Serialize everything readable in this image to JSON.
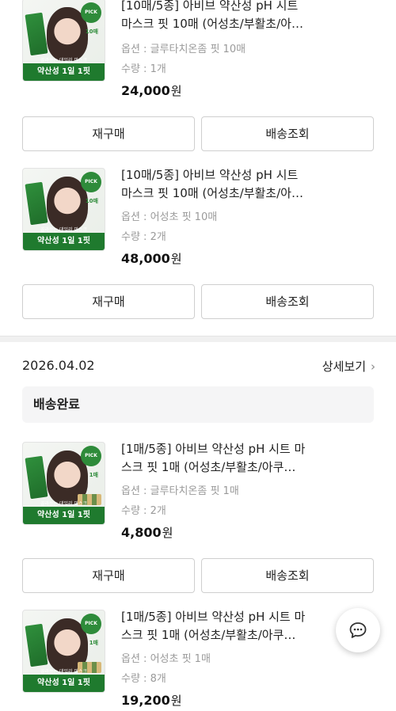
{
  "orders": [
    {
      "items": [
        {
          "title": "[10매/5종] 아비브 약산성 pH 시트\n마스크 핏 10매 (어성초/부활초/아…",
          "option": "옵션 : 글루타치온좀 핏 10매",
          "qty": "수량 : 1개",
          "price": "24,000",
          "currency": "원",
          "thumb": {
            "tag": "PICK",
            "count": "10매",
            "banner_top": "골라쓰는 데일리 마스크",
            "banner": "약산성 1일 1핏"
          },
          "buttons": {
            "reorder": "재구매",
            "track": "배송조회"
          }
        },
        {
          "title": "[10매/5종] 아비브 약산성 pH 시트\n마스크 핏 10매 (어성초/부활초/아…",
          "option": "옵션 : 어성초 핏 10매",
          "qty": "수량 : 2개",
          "price": "48,000",
          "currency": "원",
          "thumb": {
            "tag": "PICK",
            "count": "10매",
            "banner_top": "골라쓰는 데일리 마스크",
            "banner": "약산성 1일 1핏"
          },
          "buttons": {
            "reorder": "재구매",
            "track": "배송조회"
          }
        }
      ]
    },
    {
      "date": "2026.04.02",
      "detail_label": "상세보기",
      "status": "배송완료",
      "items": [
        {
          "title": "[1매/5종] 아비브 약산성 pH 시트 마\n스크 핏 1매 (어성초/부활초/아쿠…",
          "option": "옵션 : 글루타치온좀 핏 1매",
          "qty": "수량 : 2개",
          "price": "4,800",
          "currency": "원",
          "thumb": {
            "tag": "PICK",
            "count": "1매",
            "banner_top": "골라쓰는 데일리 마스크",
            "banner": "약산성 1일 1핏"
          },
          "buttons": {
            "reorder": "재구매",
            "track": "배송조회"
          }
        },
        {
          "title": "[1매/5종] 아비브 약산성 pH 시트 마\n스크 핏 1매 (어성초/부활초/아쿠…",
          "option": "옵션 : 어성초 핏 1매",
          "qty": "수량 : 8개",
          "price": "19,200",
          "currency": "원",
          "thumb": {
            "tag": "PICK",
            "count": "1매",
            "banner_top": "골라쓰는 데일리 마스크",
            "banner": "약산성 1일 1핏"
          }
        }
      ]
    }
  ],
  "chat_icon": "chat-bubble-icon",
  "colors": {
    "brand_green": "#1f7a2e",
    "muted_text": "#9a9a9a",
    "status_bg": "#f5f5f6"
  }
}
